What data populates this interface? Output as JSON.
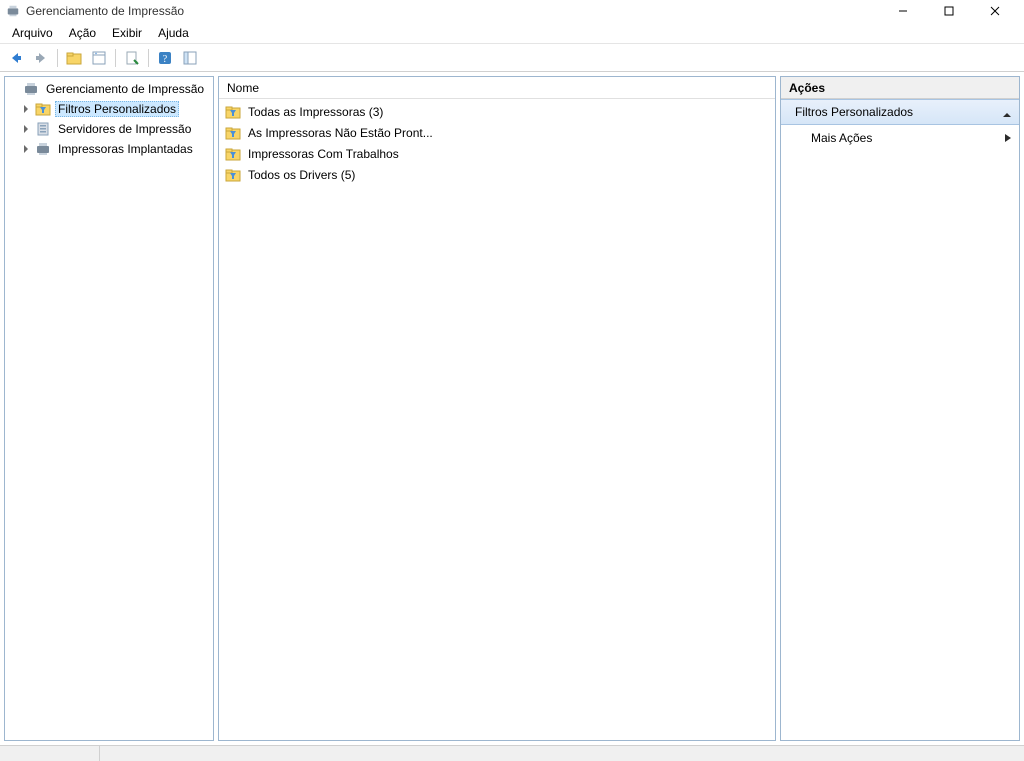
{
  "window": {
    "title": "Gerenciamento de Impressão"
  },
  "menu": {
    "arquivo": "Arquivo",
    "acao": "Ação",
    "exibir": "Exibir",
    "ajuda": "Ajuda"
  },
  "tree": {
    "root": "Gerenciamento de Impressão",
    "filtros": "Filtros Personalizados",
    "servidores": "Servidores de Impressão",
    "implantadas": "Impressoras Implantadas"
  },
  "list": {
    "header_nome": "Nome",
    "items": {
      "todas": "Todas as Impressoras (3)",
      "naoProntas": "As Impressoras Não Estão Pront...",
      "comTrabalhos": "Impressoras Com Trabalhos",
      "drivers": "Todos os Drivers (5)"
    }
  },
  "actions": {
    "header": "Ações",
    "group": "Filtros Personalizados",
    "mais": "Mais Ações"
  }
}
